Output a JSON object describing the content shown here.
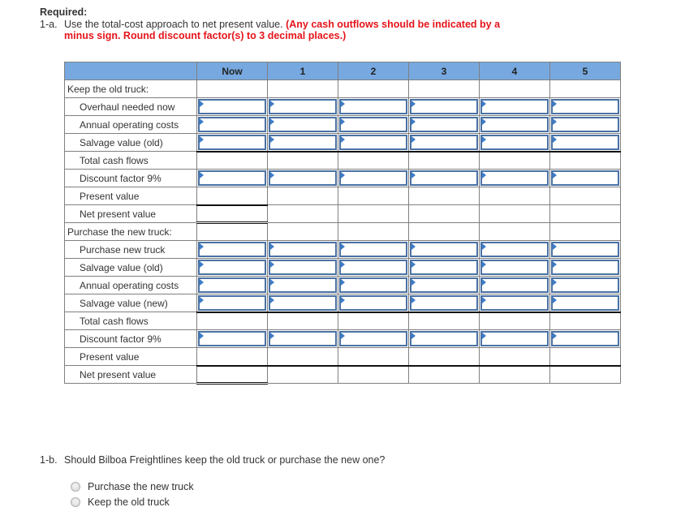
{
  "required": {
    "title": "Required:",
    "q1a_number": "1-a.",
    "q1a_text": "Use the total-cost approach to net present value.",
    "q1a_instruction_line1": "(Any cash outflows should be indicated by a",
    "q1a_instruction_line2": "minus sign. Round discount factor(s) to 3 decimal places.)"
  },
  "table": {
    "columns": [
      "",
      "Now",
      "1",
      "2",
      "3",
      "4",
      "5"
    ],
    "rows": [
      {
        "label": "Keep the old truck:",
        "type": "section"
      },
      {
        "label": "Overhaul needed now",
        "type": "input",
        "values": [
          "",
          "",
          "",
          "",
          "",
          ""
        ]
      },
      {
        "label": "Annual operating costs",
        "type": "input",
        "values": [
          "",
          "",
          "",
          "",
          "",
          ""
        ]
      },
      {
        "label": "Salvage value (old)",
        "type": "input",
        "values": [
          "",
          "",
          "",
          "",
          "",
          ""
        ]
      },
      {
        "label": "Total cash flows",
        "type": "computed",
        "values": [
          "",
          "",
          "",
          "",
          "",
          ""
        ]
      },
      {
        "label": "Discount factor 9%",
        "type": "input",
        "values": [
          "",
          "",
          "",
          "",
          "",
          ""
        ]
      },
      {
        "label": "Present value",
        "type": "computed",
        "values": [
          "",
          "",
          "",
          "",
          "",
          ""
        ]
      },
      {
        "label": "Net present value",
        "type": "total",
        "values": [
          ""
        ]
      },
      {
        "label": "Purchase the new truck:",
        "type": "section"
      },
      {
        "label": "Purchase new truck",
        "type": "input",
        "values": [
          "",
          "",
          "",
          "",
          "",
          ""
        ]
      },
      {
        "label": "Salvage value (old)",
        "type": "input",
        "values": [
          "",
          "",
          "",
          "",
          "",
          ""
        ]
      },
      {
        "label": "Annual operating costs",
        "type": "input",
        "values": [
          "",
          "",
          "",
          "",
          "",
          ""
        ]
      },
      {
        "label": "Salvage value (new)",
        "type": "input",
        "values": [
          "",
          "",
          "",
          "",
          "",
          ""
        ]
      },
      {
        "label": "Total cash flows",
        "type": "computed",
        "values": [
          "",
          "",
          "",
          "",
          "",
          ""
        ]
      },
      {
        "label": "Discount factor 9%",
        "type": "input",
        "values": [
          "",
          "",
          "",
          "",
          "",
          ""
        ]
      },
      {
        "label": "Present value",
        "type": "computed",
        "values": [
          "",
          "",
          "",
          "",
          "",
          ""
        ]
      },
      {
        "label": "Net present value",
        "type": "total",
        "values": [
          ""
        ]
      }
    ]
  },
  "q1b": {
    "number": "1-b.",
    "text": "Should Bilboa Freightlines keep the old truck or purchase the new one?",
    "options": [
      "Purchase the new truck",
      "Keep the old truck"
    ],
    "selected": null
  },
  "colors": {
    "header_bg": "#77a9e0",
    "input_border": "#4a72a4",
    "instruction_red": "#e5141b"
  }
}
